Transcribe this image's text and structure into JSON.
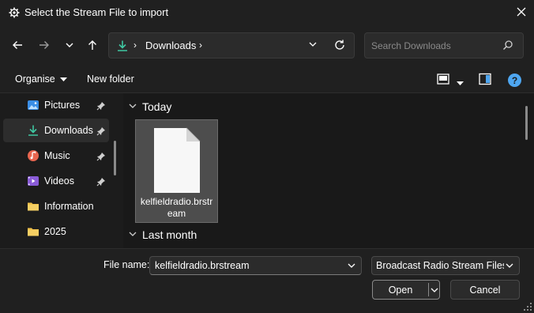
{
  "window": {
    "title": "Select the Stream File to import",
    "app_icon": "gear-icon",
    "close_icon": "close-icon"
  },
  "nav": {
    "back_icon": "arrow-left-icon",
    "forward_icon": "arrow-right-icon",
    "recent_icon": "chevron-down-icon",
    "up_icon": "arrow-up-icon",
    "address": {
      "location_icon": "download-icon",
      "separator": "›",
      "label": "Downloads",
      "dropdown_icon": "chevron-down-icon",
      "refresh_icon": "refresh-icon"
    },
    "search": {
      "placeholder": "Search Downloads",
      "icon": "search-icon"
    }
  },
  "commands": {
    "organise": "Organise",
    "new_folder": "New folder",
    "view_icon": "view-icon",
    "preview_pane_icon": "preview-pane-icon",
    "help": "?"
  },
  "sidebar": {
    "items": [
      {
        "label": "Pictures",
        "icon": "pictures-icon",
        "pinned": true,
        "selected": false
      },
      {
        "label": "Downloads",
        "icon": "download-icon",
        "pinned": true,
        "selected": true
      },
      {
        "label": "Music",
        "icon": "music-icon",
        "pinned": true,
        "selected": false
      },
      {
        "label": "Videos",
        "icon": "videos-icon",
        "pinned": true,
        "selected": false
      },
      {
        "label": "Information",
        "icon": "folder-icon",
        "pinned": false,
        "selected": false
      },
      {
        "label": "2025",
        "icon": "folder-icon",
        "pinned": false,
        "selected": false
      }
    ]
  },
  "main": {
    "groups": [
      {
        "title": "Today",
        "files": [
          {
            "name": "kelfieldradio.brstream",
            "icon": "file-icon",
            "selected": true
          }
        ]
      },
      {
        "title": "Last month",
        "files": []
      }
    ]
  },
  "footer": {
    "file_name_label": "File name:",
    "file_name_value": "kelfieldradio.brstream",
    "file_type": "Broadcast Radio Stream Files (*",
    "open": "Open",
    "cancel": "Cancel"
  },
  "colors": {
    "background": "#1c1c1c",
    "chrome": "#202020",
    "field": "#2b2b2b",
    "selected_tile": "#4d4d4d",
    "download_accent": "#3fc7a2",
    "folder": "#f0c14b",
    "help": "#4ea6f0"
  }
}
